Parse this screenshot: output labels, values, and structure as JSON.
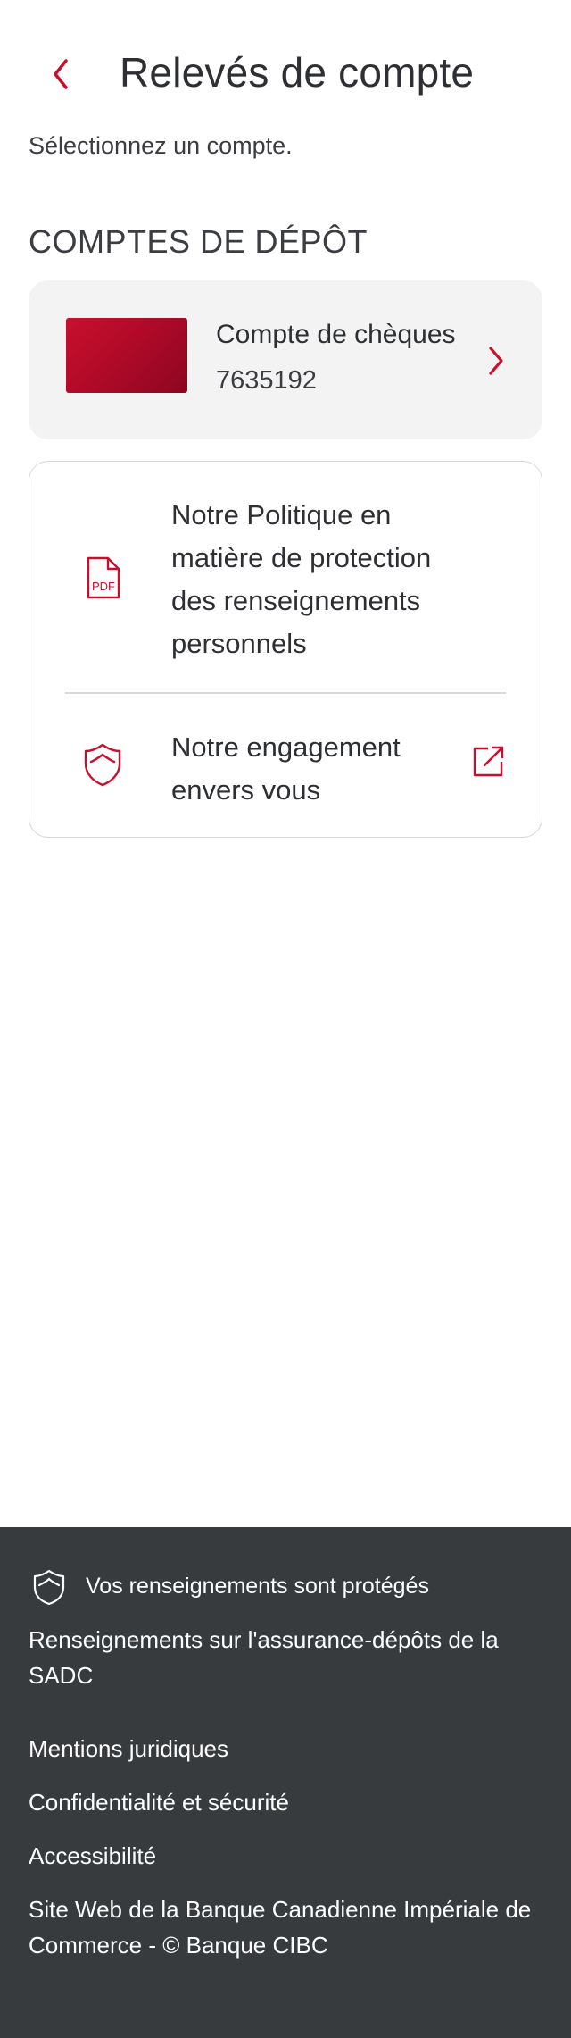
{
  "header": {
    "title": "Relevés de compte",
    "back_icon": "chevron-left-icon"
  },
  "subtitle": "Sélectionnez un compte.",
  "section": {
    "heading": "COMPTES DE DÉPÔT"
  },
  "account": {
    "name": "Compte de chèques",
    "number": "7635192",
    "card_color": "#c8102e",
    "chevron_icon": "chevron-right-icon"
  },
  "links": [
    {
      "label": "Notre Politique en matière de protection des renseignements personnels",
      "icon": "pdf-icon"
    },
    {
      "label": "Notre engagement envers vous",
      "icon": "shield-icon",
      "trailing_icon": "external-link-icon"
    }
  ],
  "footer": {
    "secure_text": "Vos renseignements sont protégés",
    "links": [
      "Renseignements sur l'assurance-dépôts de la SADC",
      "Mentions juridiques",
      "Confidentialité et sécurité",
      "Accessibilité",
      "Site Web de la Banque Canadienne Impériale de Commerce - © Banque CIBC"
    ],
    "background": "#383b3e"
  },
  "colors": {
    "accent": "#c8102e",
    "text": "#2d2f33",
    "card_bg": "#f3f3f3"
  }
}
